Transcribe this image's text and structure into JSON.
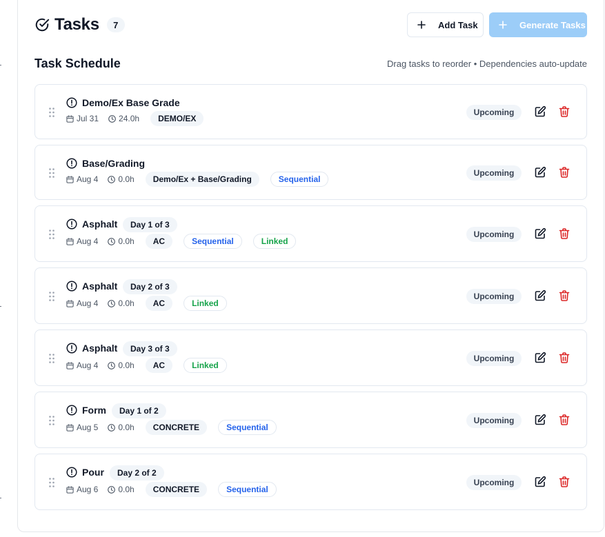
{
  "header": {
    "title": "Tasks",
    "count": "7",
    "add_label": "Add Task",
    "generate_label": "Generate Tasks"
  },
  "schedule": {
    "title": "Task Schedule",
    "hint": "Drag tasks to reorder • Dependencies auto-update"
  },
  "colors": {
    "generate_button": "#9ccdf8",
    "sequential": "#2563eb",
    "linked": "#16a34a",
    "delete": "#dc2626"
  },
  "tasks": [
    {
      "name": "Demo/Ex Base Grade",
      "day": "",
      "date": "Jul 31",
      "hours": "24.0h",
      "category": "DEMO/EX",
      "tags": [],
      "status": "Upcoming"
    },
    {
      "name": "Base/Grading",
      "day": "",
      "date": "Aug 4",
      "hours": "0.0h",
      "category": "Demo/Ex + Base/Grading",
      "tags": [
        "Sequential"
      ],
      "status": "Upcoming"
    },
    {
      "name": "Asphalt",
      "day": "Day 1 of 3",
      "date": "Aug 4",
      "hours": "0.0h",
      "category": "AC",
      "tags": [
        "Sequential",
        "Linked"
      ],
      "status": "Upcoming"
    },
    {
      "name": "Asphalt",
      "day": "Day 2 of 3",
      "date": "Aug 4",
      "hours": "0.0h",
      "category": "AC",
      "tags": [
        "Linked"
      ],
      "status": "Upcoming"
    },
    {
      "name": "Asphalt",
      "day": "Day 3 of 3",
      "date": "Aug 4",
      "hours": "0.0h",
      "category": "AC",
      "tags": [
        "Linked"
      ],
      "status": "Upcoming"
    },
    {
      "name": "Form",
      "day": "Day 1 of 2",
      "date": "Aug 5",
      "hours": "0.0h",
      "category": "CONCRETE",
      "tags": [
        "Sequential"
      ],
      "status": "Upcoming"
    },
    {
      "name": "Pour",
      "day": "Day 2 of 2",
      "date": "Aug 6",
      "hours": "0.0h",
      "category": "CONCRETE",
      "tags": [
        "Sequential"
      ],
      "status": "Upcoming"
    }
  ]
}
